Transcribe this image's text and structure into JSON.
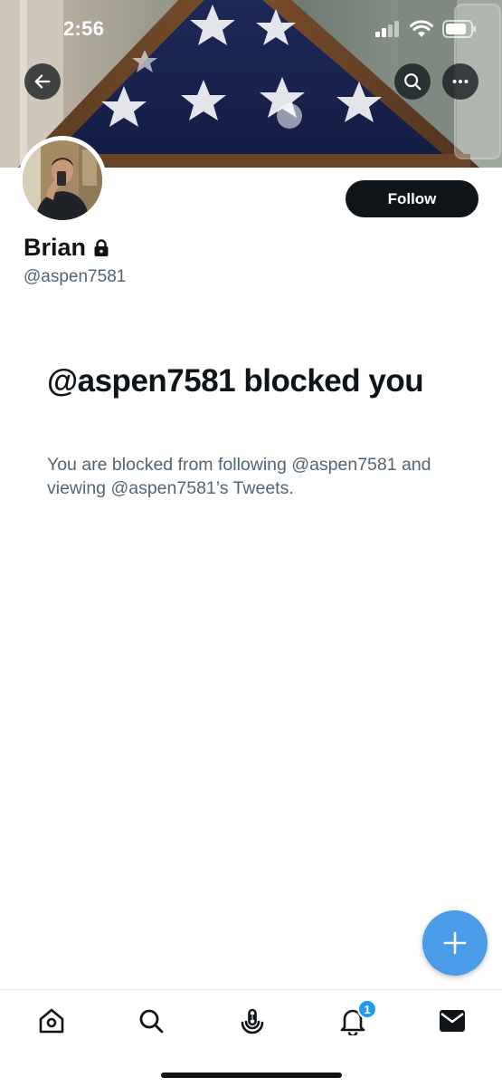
{
  "status_bar": {
    "time": "2:56"
  },
  "header": {
    "back_icon": "arrow-left-icon",
    "search_icon": "search-icon",
    "more_icon": "more-horizontal-icon"
  },
  "profile": {
    "display_name": "Brian",
    "protected_icon": "lock-icon",
    "handle": "@aspen7581",
    "follow_label": "Follow"
  },
  "blocked": {
    "title": "@aspen7581 blocked you",
    "description": "You are blocked from following @aspen7581 and viewing @aspen7581’s Tweets."
  },
  "fab": {
    "icon": "plus-icon"
  },
  "bottom_nav": {
    "items": [
      {
        "name": "home",
        "icon": "home-icon"
      },
      {
        "name": "search",
        "icon": "search-icon"
      },
      {
        "name": "spaces",
        "icon": "spaces-icon"
      },
      {
        "name": "notifications",
        "icon": "bell-icon",
        "badge": "1"
      },
      {
        "name": "messages",
        "icon": "envelope-icon"
      }
    ]
  },
  "colors": {
    "accent": "#1d9bf0",
    "fab": "#4a9be8",
    "text_primary": "#0f1419",
    "text_secondary": "#536471"
  }
}
